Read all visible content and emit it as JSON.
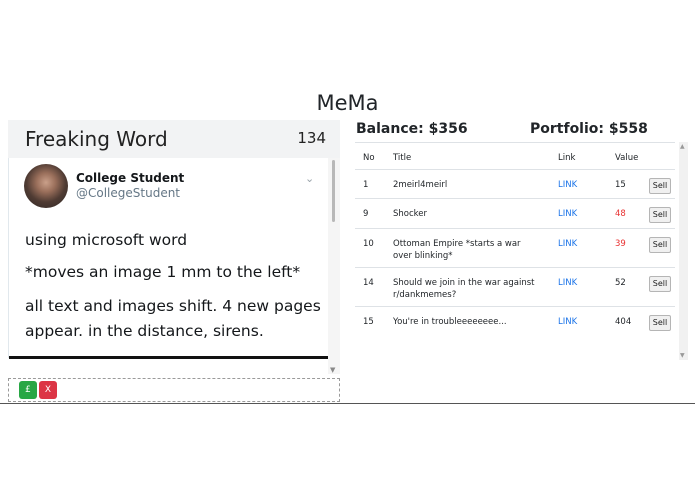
{
  "app": {
    "title": "MeMa"
  },
  "post": {
    "title": "Freaking Word",
    "score": "134",
    "tweet": {
      "author_name": "College Student",
      "author_handle": "@CollegeStudent",
      "lines": [
        "using microsoft word",
        "*moves an image 1 mm to the left*",
        "all text and images shift. 4 new pages",
        "appear. in the distance, sirens."
      ]
    }
  },
  "actions": {
    "like_label": "£",
    "dislike_label": "X"
  },
  "account": {
    "balance": "Balance: $356",
    "portfolio": "Portfolio: $558"
  },
  "holdings": {
    "headers": {
      "no": "No",
      "title": "Title",
      "link": "Link",
      "value": "Value"
    },
    "sell_label": "Sell",
    "rows": [
      {
        "no": "1",
        "title": "2meirl4meirl",
        "link": "LINK",
        "value": "15",
        "value_color": "normal"
      },
      {
        "no": "9",
        "title": "Shocker",
        "link": "LINK",
        "value": "48",
        "value_color": "red"
      },
      {
        "no": "10",
        "title": "Ottoman Empire *starts a war over blinking*",
        "link": "LINK",
        "value": "39",
        "value_color": "red"
      },
      {
        "no": "14",
        "title": "Should we join in the war against r/dankmemes?",
        "link": "LINK",
        "value": "52",
        "value_color": "normal"
      },
      {
        "no": "15",
        "title": "You're in troubleeeeeeee...",
        "link": "LINK",
        "value": "404",
        "value_color": "normal"
      }
    ]
  },
  "colors": {
    "accent_link": "#1a73e8",
    "like": "#28a745",
    "dislike": "#dc3545",
    "loss": "#e83030"
  }
}
